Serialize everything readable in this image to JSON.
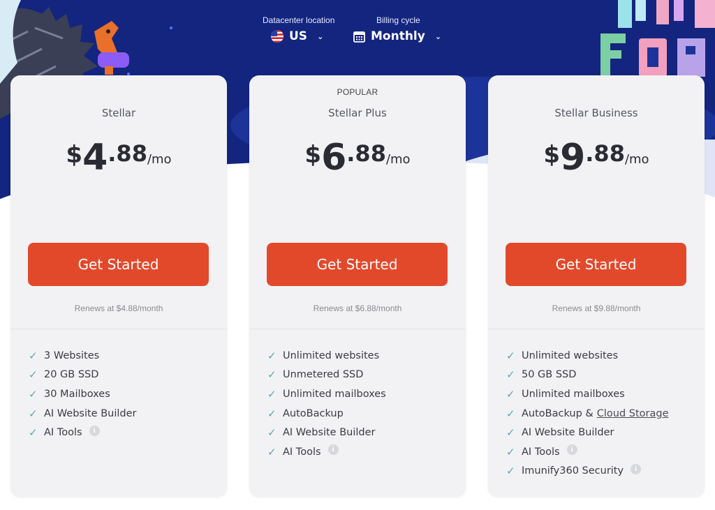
{
  "selectors": {
    "location": {
      "label": "Datacenter location",
      "value": "US",
      "icon": "us-flag-icon"
    },
    "billing": {
      "label": "Billing cycle",
      "value": "Monthly",
      "icon": "calendar-icon"
    }
  },
  "colors": {
    "hero": "#13257f",
    "cta": "#e2492b",
    "check": "#5ea5ad"
  },
  "plans": [
    {
      "badge": "",
      "name": "Stellar",
      "currency": "$",
      "whole": "4",
      "cents": ".88",
      "per": "/mo",
      "cta": "Get Started",
      "renew": "Renews at $4.88/month",
      "features": [
        "3 Websites",
        "20 GB SSD",
        "30 Mailboxes",
        "AI Website Builder",
        "AI Tools"
      ]
    },
    {
      "badge": "POPULAR",
      "name": "Stellar Plus",
      "currency": "$",
      "whole": "6",
      "cents": ".88",
      "per": "/mo",
      "cta": "Get Started",
      "renew": "Renews at $6.88/month",
      "features": [
        "Unlimited websites",
        "Unmetered SSD",
        "Unlimited mailboxes",
        "AutoBackup",
        "AI Website Builder",
        "AI Tools"
      ]
    },
    {
      "badge": "",
      "name": "Stellar Business",
      "currency": "$",
      "whole": "9",
      "cents": ".88",
      "per": "/mo",
      "cta": "Get Started",
      "renew": "Renews at $9.88/month",
      "features": [
        "Unlimited websites",
        "50 GB SSD",
        "Unlimited mailboxes",
        "AutoBackup &",
        "AI Website Builder",
        "AI Tools",
        "Imunify360 Security"
      ],
      "feature_link": "Cloud Storage"
    }
  ]
}
